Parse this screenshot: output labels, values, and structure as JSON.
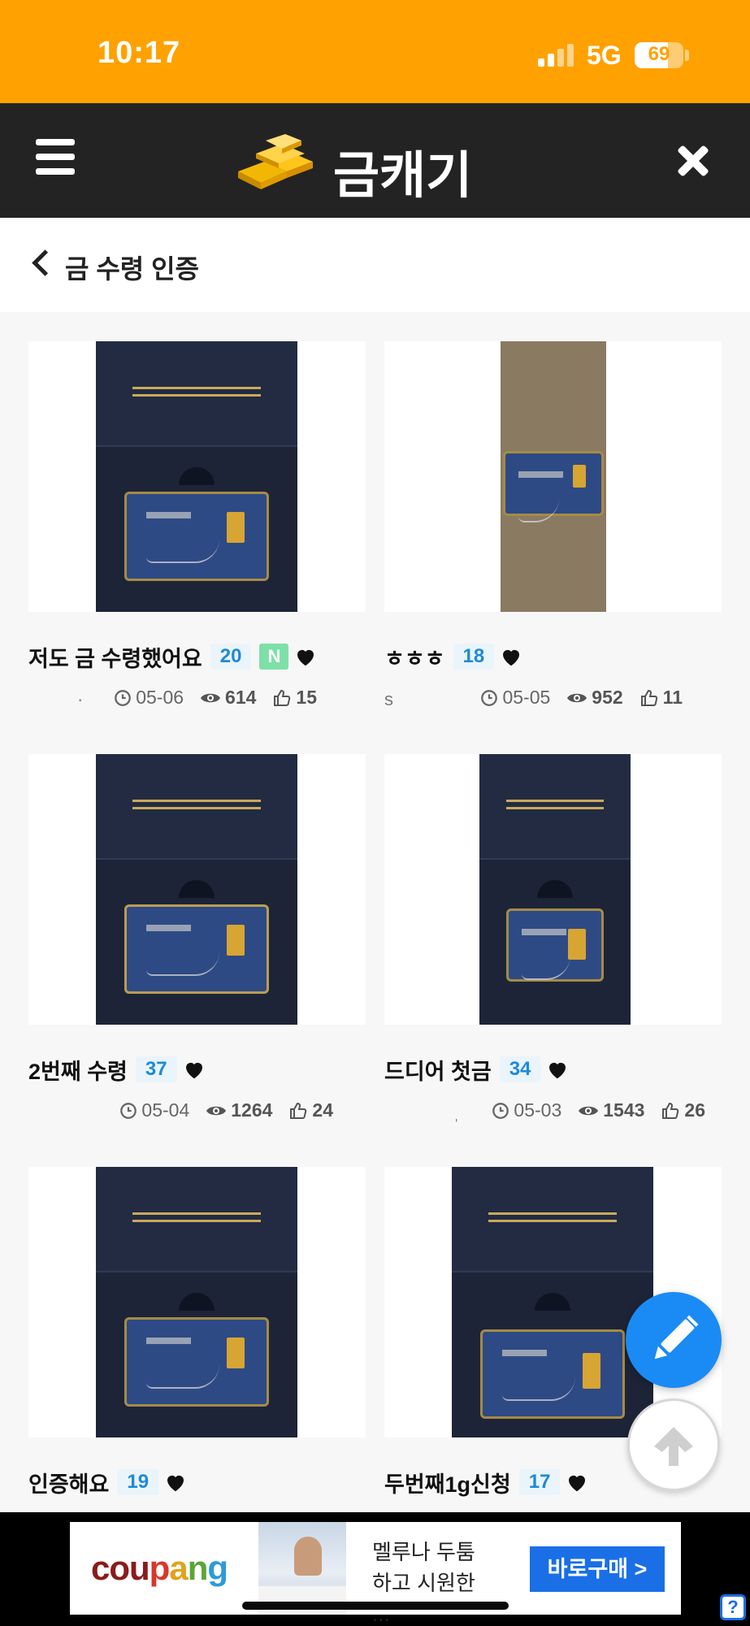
{
  "status_bar": {
    "time": "10:17",
    "network": "5G",
    "battery": "69",
    "battery_level": 0.69
  },
  "header": {
    "app_name": "금캐기",
    "logo_icon": "gold-bars-icon",
    "menu_icon": "hamburger-menu-icon",
    "close_icon": "close-icon"
  },
  "subheader": {
    "title": "금 수령 인증",
    "back_icon": "chevron-left-icon"
  },
  "posts": [
    {
      "title": "저도 금 수령했어요",
      "count": "20",
      "new_badge": "N",
      "author": "·",
      "date": "05-06",
      "views": "614",
      "likes": "15"
    },
    {
      "title": "ㅎㅎㅎ",
      "count": "18",
      "author": "s",
      "date": "05-05",
      "views": "952",
      "likes": "11"
    },
    {
      "title": "2번째 수령",
      "count": "37",
      "date": "05-04",
      "views": "1264",
      "likes": "24"
    },
    {
      "title": "드디어 첫금",
      "count": "34",
      "author": "ˌ",
      "date": "05-03",
      "views": "1543",
      "likes": "26"
    },
    {
      "title": "인증해요",
      "count": "19"
    },
    {
      "title": "두번째1g신청",
      "count": "17"
    }
  ],
  "fab": {
    "write_icon": "pencil-icon",
    "scroll_top_icon": "arrow-up-icon"
  },
  "ad": {
    "brand": [
      "cou",
      "p",
      "a",
      "n",
      "g"
    ],
    "text": "멜루나 두툼하고 시원한 ...",
    "cta": "바로구매 >",
    "help_icon": "question-icon",
    "help_text": "?"
  },
  "colors": {
    "status_bar": "#ffa100",
    "top_bar": "#232323",
    "accent_blue": "#1a8bf5",
    "badge_text": "#1e8ad8",
    "new_badge": "#7de0a8"
  }
}
